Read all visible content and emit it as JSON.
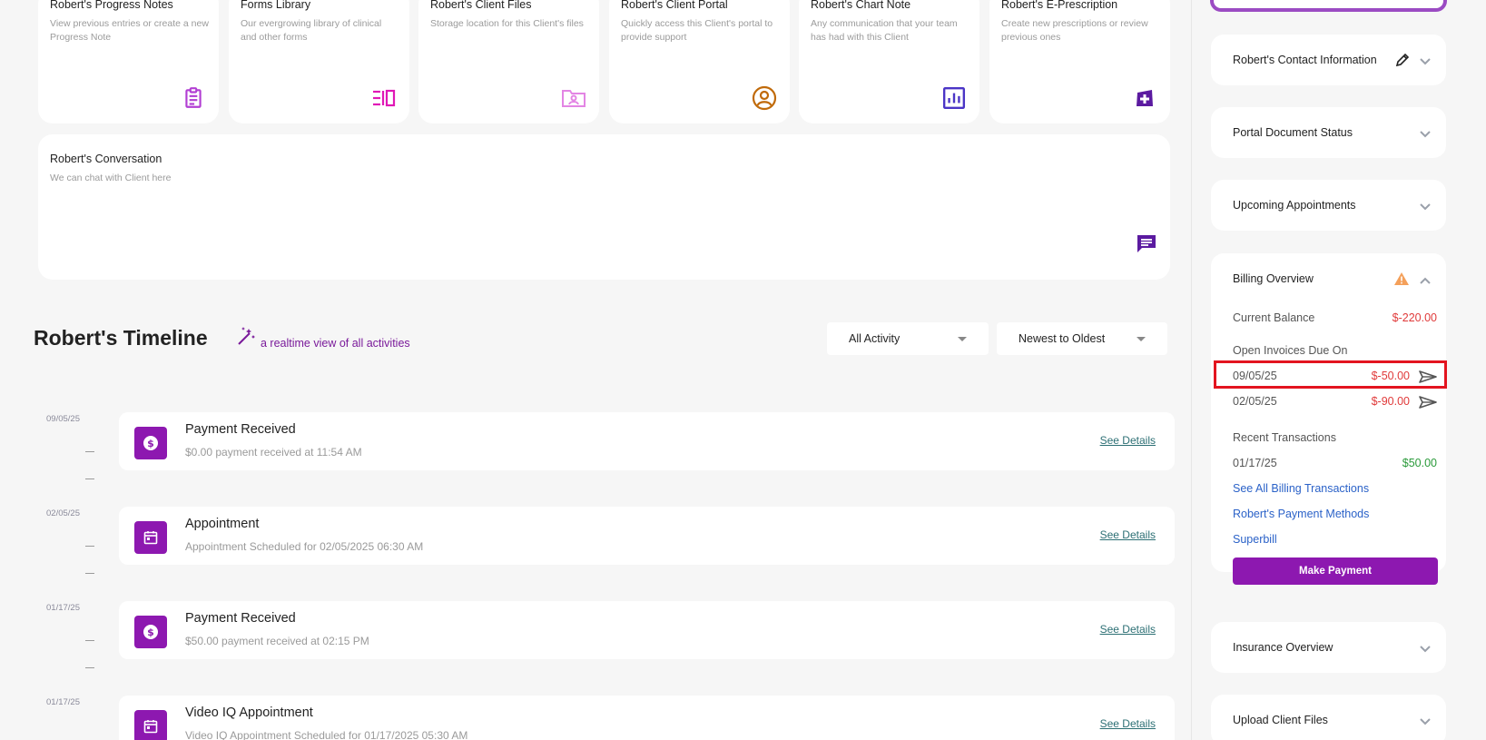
{
  "top_cards": [
    {
      "title": "Robert's Progress Notes",
      "desc": "View previous entries or create a new Progress Note",
      "icon": "clipboard-icon",
      "color": "#b23fd3"
    },
    {
      "title": "Forms Library",
      "desc": "Our evergrowing library of clinical and other forms",
      "icon": "forms-library-icon",
      "color": "#e018b6"
    },
    {
      "title": "Robert's Client Files",
      "desc": "Storage location for this Client's files",
      "icon": "folder-icon",
      "color": "#e385e4"
    },
    {
      "title": "Robert's Client Portal",
      "desc": "Quickly access this Client's portal to provide support",
      "icon": "user-circle-icon",
      "color": "#c06a0a"
    },
    {
      "title": "Robert's Chart Note",
      "desc": "Any communication that your team has had with this Client",
      "icon": "bar-chart-icon",
      "color": "#4b35c6"
    },
    {
      "title": "Robert's E-Prescription",
      "desc": "Create new prescriptions or review previous ones",
      "icon": "prescription-icon",
      "color": "#5b1aa0"
    }
  ],
  "conversation": {
    "title": "Robert's Conversation",
    "desc": "We can chat with Client here",
    "icon": "chat-icon",
    "color": "#5b1aa0"
  },
  "timeline": {
    "title": "Robert's Timeline",
    "subtitle": "a realtime view of all activities",
    "filter": "All Activity",
    "sort": "Newest to Oldest",
    "items": [
      {
        "date": "09/05/25",
        "title": "Payment Received",
        "sub": "$0.00 payment received at 11:54 AM",
        "icon": "dollar-icon",
        "link": "See Details"
      },
      {
        "date": "02/05/25",
        "title": "Appointment",
        "sub": "Appointment Scheduled for 02/05/2025 06:30 AM",
        "icon": "calendar-icon",
        "link": "See Details"
      },
      {
        "date": "01/17/25",
        "title": "Payment Received",
        "sub": "$50.00 payment received at 02:15 PM",
        "icon": "dollar-icon",
        "link": "See Details"
      },
      {
        "date": "01/17/25",
        "title": "Video IQ Appointment",
        "sub": "Video IQ Appointment Scheduled for 01/17/2025 05:30 AM",
        "icon": "calendar-icon",
        "link": "See Details"
      }
    ]
  },
  "sidebar": {
    "contact": "Robert's Contact Information",
    "portal_status": "Portal Document Status",
    "appointments": "Upcoming Appointments",
    "billing": {
      "title": "Billing Overview",
      "current_balance_label": "Current Balance",
      "current_balance": "$-220.00",
      "open_invoices_label": "Open Invoices Due On",
      "invoices": [
        {
          "date": "09/05/25",
          "amount": "$-50.00"
        },
        {
          "date": "02/05/25",
          "amount": "$-90.00"
        }
      ],
      "recent_label": "Recent Transactions",
      "recent": {
        "date": "01/17/25",
        "amount": "$50.00"
      },
      "links": [
        "See All Billing Transactions",
        "Robert's Payment Methods",
        "Superbill"
      ],
      "pay_button": "Make Payment"
    },
    "insurance": "Insurance Overview",
    "upload": "Upload Client Files"
  },
  "colors": {
    "accent": "#8d18b0",
    "negative": "#e03a3a",
    "positive": "#2a9a3a",
    "link": "#2b62c8"
  }
}
